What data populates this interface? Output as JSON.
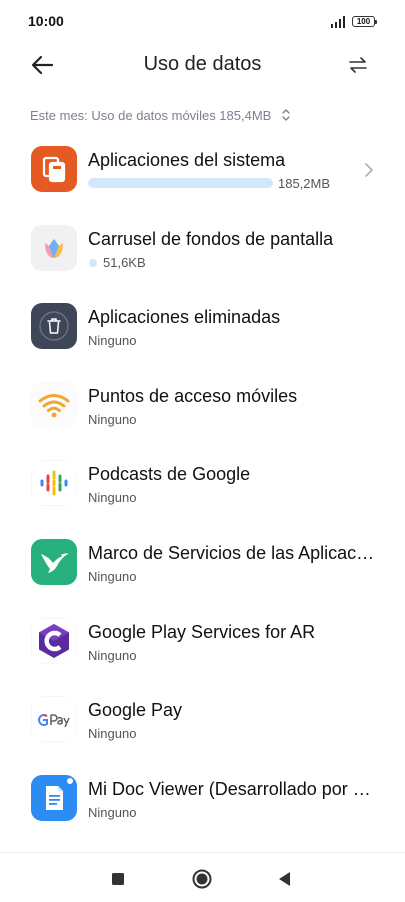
{
  "status_bar": {
    "time": "10:00",
    "battery": "100"
  },
  "header": {
    "title": "Uso de datos",
    "back_icon": "arrow-left-icon",
    "switch_icon": "swap-arrows-icon"
  },
  "month_selector": {
    "label": "Este mes: Uso de datos móviles 185,4MB"
  },
  "apps": [
    {
      "name": "Aplicaciones del sistema",
      "usage": "185,2MB",
      "icon": "system-apps-icon",
      "usage_fraction": 1.0,
      "has_chevron": true
    },
    {
      "name": "Carrusel de fondos de pantalla",
      "usage": "51,6KB",
      "icon": "wallpaper-carousel-icon",
      "has_dot": true
    },
    {
      "name": "Aplicaciones eliminadas",
      "usage": "Ninguno",
      "icon": "trash-icon"
    },
    {
      "name": "Puntos de acceso móviles",
      "usage": "Ninguno",
      "icon": "wifi-hotspot-icon"
    },
    {
      "name": "Podcasts de Google",
      "usage": "Ninguno",
      "icon": "google-podcasts-icon"
    },
    {
      "name": "Marco de Servicios de las Aplicaciones",
      "usage": "Ninguno",
      "icon": "hummingbird-icon"
    },
    {
      "name": "Google Play Services for AR",
      "usage": "Ninguno",
      "icon": "arcore-icon"
    },
    {
      "name": "Google Pay",
      "usage": "Ninguno",
      "icon": "google-pay-icon"
    },
    {
      "name": "Mi Doc Viewer (Desarrollado por WPS Office)",
      "usage": "Ninguno",
      "icon": "document-viewer-icon"
    }
  ],
  "nav_bar": {
    "recent_icon": "square-recents-icon",
    "home_icon": "circle-home-icon",
    "back_icon": "triangle-back-icon"
  }
}
